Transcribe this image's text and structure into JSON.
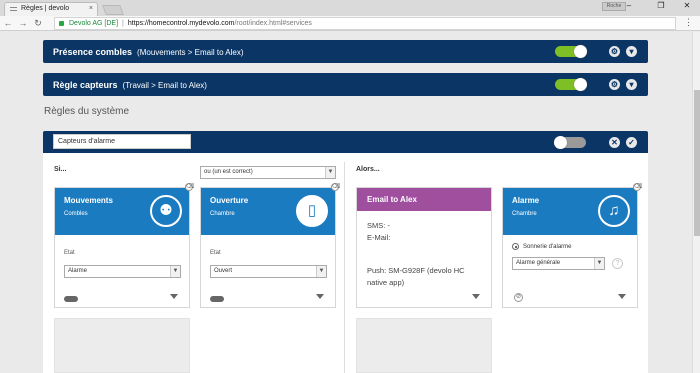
{
  "browser": {
    "tab_title": "Règles | devolo",
    "profile": "Roche",
    "site_name": "Devolo AG [DE]",
    "url_host": "https://homecontrol.mydevolo.com",
    "url_path": "/root/index.html#services"
  },
  "rules_top": [
    {
      "name": "Présence combles",
      "detail": "(Mouvements > Email to Alex)"
    },
    {
      "name": "Règle capteurs",
      "detail": "(Travail > Email to Alex)"
    }
  ],
  "section_title": "Règles du système",
  "rule": {
    "name": "Capteurs d'alarme",
    "si_label": "Si...",
    "alors_label": "Alors...",
    "logic_select": "ou (un est correct)"
  },
  "conditions": [
    {
      "title": "Mouvements",
      "location": "Combles",
      "state_label": "Etat",
      "state_value": "Alarme",
      "icon": "motion-sensor-icon"
    },
    {
      "title": "Ouverture",
      "location": "Chambre",
      "state_label": "Etat",
      "state_value": "Ouvert",
      "icon": "door-contact-icon"
    }
  ],
  "actions": {
    "email": {
      "title": "Email to Alex",
      "sms": "SMS: -",
      "email": "E-Mail:",
      "push_line1": "Push: SM-G928F (devolo HC",
      "push_line2": "native app)"
    },
    "alarm": {
      "title": "Alarme",
      "location": "Chambre",
      "radio_label": "Sonnerie d'alarme",
      "select_value": "Alarme générale",
      "icon": "bell-icon"
    }
  },
  "colors": {
    "navy": "#0a3564",
    "blue": "#1b7bc0",
    "purple": "#a04f9f",
    "green": "#7fbf26"
  }
}
